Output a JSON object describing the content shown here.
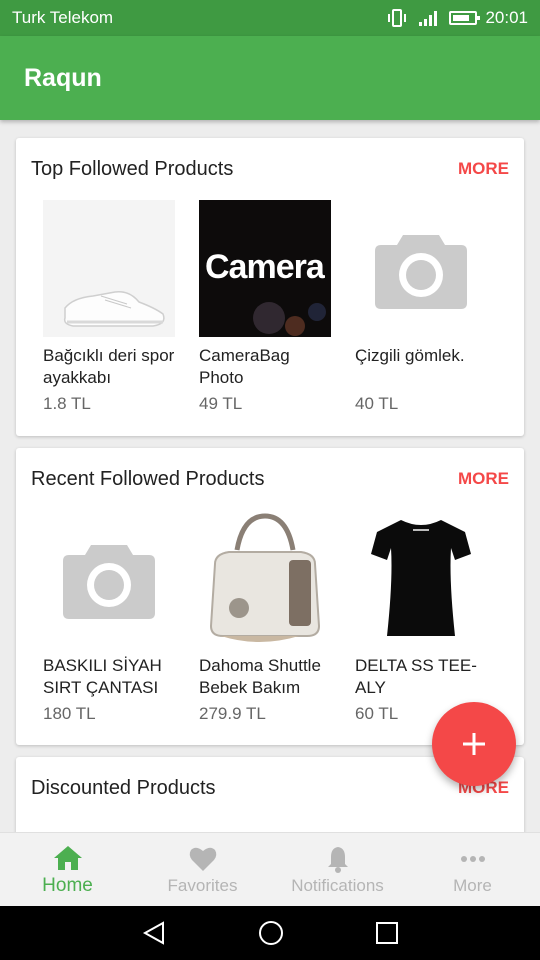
{
  "status_bar": {
    "carrier": "Turk Telekom",
    "time": "20:01"
  },
  "app": {
    "title": "Raqun"
  },
  "sections": [
    {
      "title": "Top Followed Products",
      "more_label": "MORE",
      "products": [
        {
          "name": "Bağcıklı deri spor ayakkabı",
          "price": "1.8 TL",
          "image": "white-sneaker"
        },
        {
          "name": "CameraBag Photo",
          "price": "49 TL",
          "image": "camerabag-logo"
        },
        {
          "name": "Çizgili gömlek.",
          "price": "40 TL",
          "image": "camera-placeholder-icon"
        }
      ]
    },
    {
      "title": "Recent Followed Products",
      "more_label": "MORE",
      "products": [
        {
          "name": "BASKILI SİYAH SIRT ÇANTASI",
          "price": "180 TL",
          "image": "camera-placeholder-icon"
        },
        {
          "name": "Dahoma Shuttle Bebek Bakım",
          "price": "279.9 TL",
          "image": "baby-changing-bag"
        },
        {
          "name": "DELTA SS TEE-ALY",
          "price": "60 TL",
          "image": "black-tee"
        }
      ]
    },
    {
      "title": "Discounted Products",
      "more_label": "MORE"
    }
  ],
  "camerabag_text": "Camera",
  "fab": {
    "icon": "plus-icon",
    "label": "+"
  },
  "bottom_nav": [
    {
      "label": "Home",
      "icon": "home-icon"
    },
    {
      "label": "Favorites",
      "icon": "heart-icon"
    },
    {
      "label": "Notifications",
      "icon": "bell-icon"
    },
    {
      "label": "More",
      "icon": "more-dots-icon"
    }
  ],
  "colors": {
    "primary": "#4caf50",
    "status_bar": "#3f9a42",
    "accent": "#f44848",
    "placeholder": "#cbcbcb"
  }
}
